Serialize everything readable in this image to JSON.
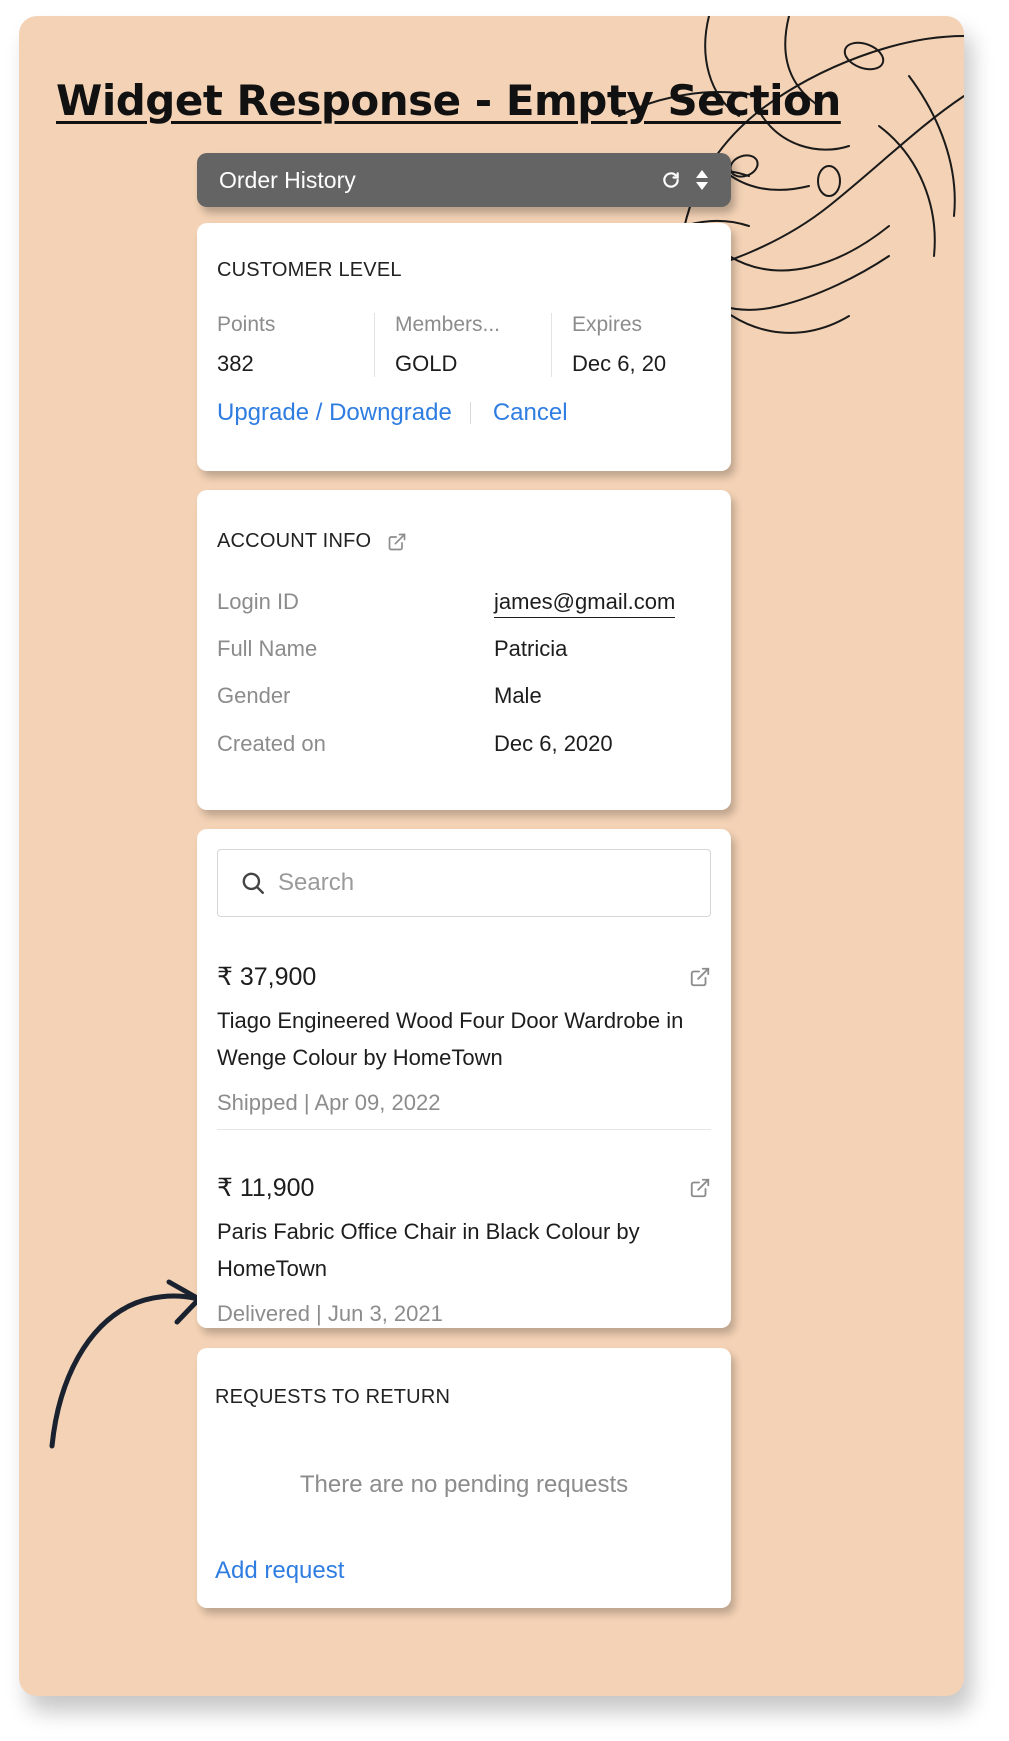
{
  "page": {
    "title": "Widget Response - Empty Section"
  },
  "header": {
    "title": "Order History",
    "refresh_icon": "refresh-icon",
    "sort_icon": "sort-icon"
  },
  "customer_level": {
    "heading": "CUSTOMER LEVEL",
    "columns": [
      {
        "label": "Points",
        "value": "382"
      },
      {
        "label": "Members...",
        "value": "GOLD"
      },
      {
        "label": "Expires",
        "value": "Dec 6, 20"
      }
    ],
    "upgrade_label": "Upgrade / Downgrade",
    "cancel_label": "Cancel"
  },
  "account_info": {
    "heading": "ACCOUNT INFO",
    "rows": [
      {
        "key": "Login ID",
        "value": "james@gmail.com"
      },
      {
        "key": "Full Name",
        "value": "Patricia"
      },
      {
        "key": "Gender",
        "value": "Male"
      },
      {
        "key": "Created on",
        "value": "Dec 6, 2020"
      }
    ]
  },
  "orders": {
    "search_placeholder": "Search",
    "items": [
      {
        "price": "₹ 37,900",
        "description": "Tiago Engineered Wood Four Door Wardrobe in Wenge Colour by HomeTown",
        "status": "Shipped | Apr 09, 2022"
      },
      {
        "price": "₹ 11,900",
        "description": "Paris Fabric Office Chair in Black Colour by HomeTown",
        "status": "Delivered | Jun 3, 2021"
      }
    ]
  },
  "requests": {
    "heading": "REQUESTS TO RETURN",
    "empty_message": "There are no pending requests",
    "add_label": "Add request"
  },
  "colors": {
    "background": "#f3d2b5",
    "header_bar": "#646464",
    "link": "#2f7de1",
    "muted_text": "#8c8c8c"
  }
}
